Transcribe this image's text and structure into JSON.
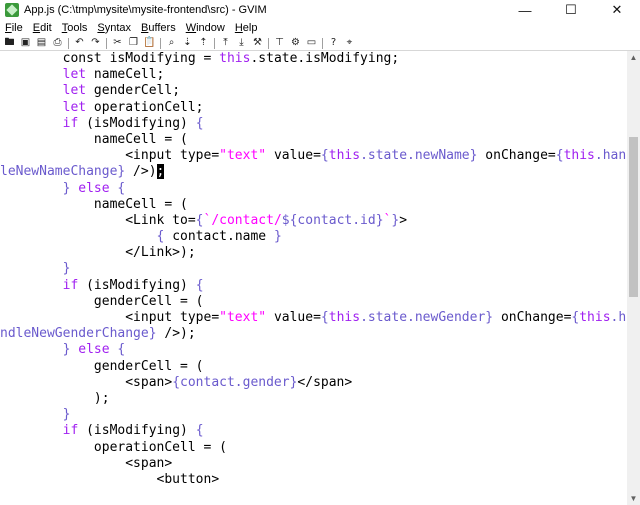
{
  "window": {
    "title": "App.js (C:\\tmp\\mysite\\mysite-frontend\\src) - GVIM",
    "minimize": "—",
    "maximize": "☐",
    "close": "✕"
  },
  "menu": [
    {
      "key": "F",
      "rest": "ile"
    },
    {
      "key": "E",
      "rest": "dit"
    },
    {
      "key": "T",
      "rest": "ools"
    },
    {
      "key": "S",
      "rest": "yntax"
    },
    {
      "key": "B",
      "rest": "uffers"
    },
    {
      "key": "W",
      "rest": "indow"
    },
    {
      "key": "H",
      "rest": "elp"
    }
  ],
  "toolbar": [
    {
      "name": "open-icon",
      "glyph": "🖿"
    },
    {
      "name": "save-icon",
      "glyph": "▣"
    },
    {
      "name": "save-all-icon",
      "glyph": "▤"
    },
    {
      "name": "print-icon",
      "glyph": "⎙"
    },
    {
      "sep": true
    },
    {
      "name": "undo-icon",
      "glyph": "↶"
    },
    {
      "name": "redo-icon",
      "glyph": "↷"
    },
    {
      "sep": true
    },
    {
      "name": "cut-icon",
      "glyph": "✂"
    },
    {
      "name": "copy-icon",
      "glyph": "❐"
    },
    {
      "name": "paste-icon",
      "glyph": "📋"
    },
    {
      "sep": true
    },
    {
      "name": "find-replace-icon",
      "glyph": "⌕"
    },
    {
      "name": "find-next-icon",
      "glyph": "⇣"
    },
    {
      "name": "find-prev-icon",
      "glyph": "⇡"
    },
    {
      "sep": true
    },
    {
      "name": "load-session-icon",
      "glyph": "⤒"
    },
    {
      "name": "save-session-icon",
      "glyph": "⤓"
    },
    {
      "name": "run-script-icon",
      "glyph": "⚒"
    },
    {
      "sep": true
    },
    {
      "name": "make-icon",
      "glyph": "⊤"
    },
    {
      "name": "shell-icon",
      "glyph": "⚙"
    },
    {
      "name": "ctags-icon",
      "glyph": "▭"
    },
    {
      "sep": true
    },
    {
      "name": "help-icon",
      "glyph": "?"
    },
    {
      "name": "find-help-icon",
      "glyph": "⌖"
    }
  ],
  "code_lines": [
    [
      [
        "t",
        "        const isModifying = "
      ],
      [
        "kw",
        "this"
      ],
      [
        "t",
        ".state.isModifying;"
      ]
    ],
    [
      [
        "t",
        "        "
      ],
      [
        "kw",
        "let"
      ],
      [
        "t",
        " nameCell;"
      ]
    ],
    [
      [
        "t",
        "        "
      ],
      [
        "kw",
        "let"
      ],
      [
        "t",
        " genderCell;"
      ]
    ],
    [
      [
        "t",
        "        "
      ],
      [
        "kw",
        "let"
      ],
      [
        "t",
        " operationCell;"
      ]
    ],
    [
      [
        "t",
        "        "
      ],
      [
        "kw",
        "if"
      ],
      [
        "t",
        " (isModifying) "
      ],
      [
        "br",
        "{"
      ]
    ],
    [
      [
        "t",
        "            nameCell = ("
      ]
    ],
    [
      [
        "t",
        "                <input type="
      ],
      [
        "str",
        "\"text\""
      ],
      [
        "t",
        " value="
      ],
      [
        "br",
        "{"
      ],
      [
        "kw",
        "this"
      ],
      [
        "br",
        ".state.newName}"
      ],
      [
        "t",
        " onChange="
      ],
      [
        "br",
        "{"
      ],
      [
        "kw",
        "this"
      ],
      [
        "br",
        ".hand"
      ]
    ],
    [
      [
        "br",
        "leNewNameChange}"
      ],
      [
        "t",
        " />)"
      ],
      [
        "cur",
        ";"
      ]
    ],
    [
      [
        "t",
        "        "
      ],
      [
        "br",
        "}"
      ],
      [
        "t",
        " "
      ],
      [
        "kw",
        "else"
      ],
      [
        "t",
        " "
      ],
      [
        "br",
        "{"
      ]
    ],
    [
      [
        "t",
        "            nameCell = ("
      ]
    ],
    [
      [
        "t",
        "                <Link to="
      ],
      [
        "br",
        "{"
      ],
      [
        "str",
        "`/contact/"
      ],
      [
        "br",
        "${contact.id}"
      ],
      [
        "str",
        "`"
      ],
      [
        "br",
        "}"
      ],
      [
        "t",
        ">"
      ]
    ],
    [
      [
        "t",
        "                    "
      ],
      [
        "br",
        "{"
      ],
      [
        "t",
        " contact.name "
      ],
      [
        "br",
        "}"
      ]
    ],
    [
      [
        "t",
        "                </Link>);"
      ]
    ],
    [
      [
        "t",
        "        "
      ],
      [
        "br",
        "}"
      ]
    ],
    [
      [
        "t",
        "        "
      ],
      [
        "kw",
        "if"
      ],
      [
        "t",
        " (isModifying) "
      ],
      [
        "br",
        "{"
      ]
    ],
    [
      [
        "t",
        "            genderCell = ("
      ]
    ],
    [
      [
        "t",
        "                <input type="
      ],
      [
        "str",
        "\"text\""
      ],
      [
        "t",
        " value="
      ],
      [
        "br",
        "{"
      ],
      [
        "kw",
        "this"
      ],
      [
        "br",
        ".state.newGender}"
      ],
      [
        "t",
        " onChange="
      ],
      [
        "br",
        "{"
      ],
      [
        "kw",
        "this"
      ],
      [
        "br",
        ".ha"
      ]
    ],
    [
      [
        "br",
        "ndleNewGenderChange}"
      ],
      [
        "t",
        " />);"
      ]
    ],
    [
      [
        "t",
        "        "
      ],
      [
        "br",
        "}"
      ],
      [
        "t",
        " "
      ],
      [
        "kw",
        "else"
      ],
      [
        "t",
        " "
      ],
      [
        "br",
        "{"
      ]
    ],
    [
      [
        "t",
        "            genderCell = ("
      ]
    ],
    [
      [
        "t",
        "                <span>"
      ],
      [
        "br",
        "{contact.gender}"
      ],
      [
        "t",
        "</span>"
      ]
    ],
    [
      [
        "t",
        "            );"
      ]
    ],
    [
      [
        "t",
        "        "
      ],
      [
        "br",
        "}"
      ]
    ],
    [
      [
        "t",
        "        "
      ],
      [
        "kw",
        "if"
      ],
      [
        "t",
        " (isModifying) "
      ],
      [
        "br",
        "{"
      ]
    ],
    [
      [
        "t",
        "            operationCell = ("
      ]
    ],
    [
      [
        "t",
        "                <span>"
      ]
    ],
    [
      [
        "t",
        "                    <button>"
      ]
    ]
  ]
}
